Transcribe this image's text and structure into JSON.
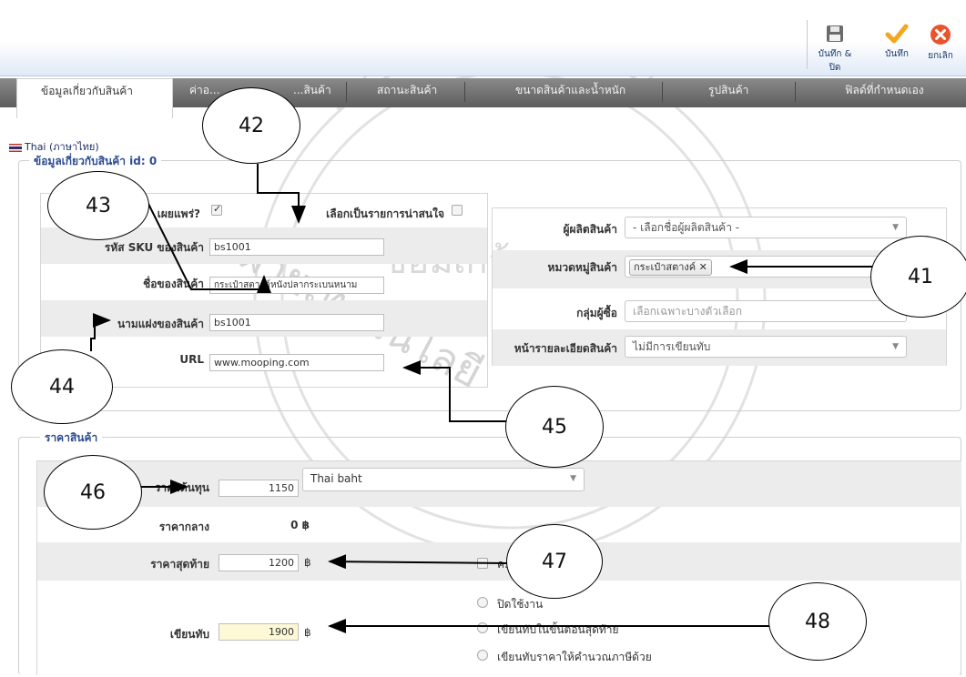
{
  "toolbar": {
    "save_close_label": "บันทึก & ปิด",
    "save_label": "บันทึก",
    "cancel_label": "ยกเลิก"
  },
  "tabs": [
    {
      "label": "ข้อมูลเกี่ยวกับสินค้า"
    },
    {
      "label": "ค่าอ..."
    },
    {
      "label": "...สินค้า"
    },
    {
      "label": "สถานะสินค้า"
    },
    {
      "label": "ขนาดสินค้าและน้ำหนัก"
    },
    {
      "label": "รูปสินค้า"
    },
    {
      "label": "ฟิลด์ที่กำหนดเอง"
    }
  ],
  "language": "Thai (ภาษาไทย)",
  "info_section": {
    "legend": "ข้อมูลเกี่ยวกับสินค้า id: 0",
    "publish_label": "เผยแพร่?",
    "publish_checked": true,
    "featured_label": "เลือกเป็นรายการน่าสนใจ",
    "featured_checked": false,
    "sku_label": "รหัส SKU ของสินค้า",
    "sku_value": "bs1001",
    "name_label": "ชื่อของสินค้า",
    "name_value": "กระเป๋าสตางค์หนังปลากระเบนหนาม",
    "alias_label": "นามแฝงของสินค้า",
    "alias_value": "bs1001",
    "url_label": "URL",
    "url_value": "www.mooping.com",
    "manufacturer_label": "ผู้ผลิตสินค้า",
    "manufacturer_value": "- เลือกชื่อผู้ผลิตสินค้า -",
    "category_label": "หมวดหมู่สินค้า",
    "category_tag": "กระเป๋าสตางค์",
    "customer_group_label": "กลุ่มผู้ซื้อ",
    "customer_group_placeholder": "เลือกเฉพาะบางตัวเลือก",
    "detail_page_label": "หน้ารายละเอียดสินค้า",
    "detail_page_value": "ไม่มีการเขียนทับ"
  },
  "price_section": {
    "legend": "ราคาสินค้า",
    "cost_label": "ราคาต้นทุน",
    "cost_value": "1150",
    "currency_value": "Thai baht",
    "base_label": "ราคากลาง",
    "base_value": "0 ฿",
    "final_label": "ราคาสุดท้าย",
    "final_value": "1200",
    "final_unit": "฿",
    "option_partial": "ค...",
    "override_label": "เขียนทับ",
    "override_value": "1900",
    "override_unit": "฿",
    "override_options": [
      "ปิดใช้งาน",
      "เขียนทับในขั้นตอนสุดท้าย",
      "เขียนทับราคาให้คำนวณภาษีด้วย"
    ]
  },
  "callouts": [
    "41",
    "42",
    "43",
    "44",
    "45",
    "46",
    "47",
    "48"
  ],
  "colors": {
    "legend_blue": "#2c4c90",
    "tab_dark": "#5d5d5d",
    "save_check": "#f2a71e",
    "cancel_red": "#e8552c"
  }
}
